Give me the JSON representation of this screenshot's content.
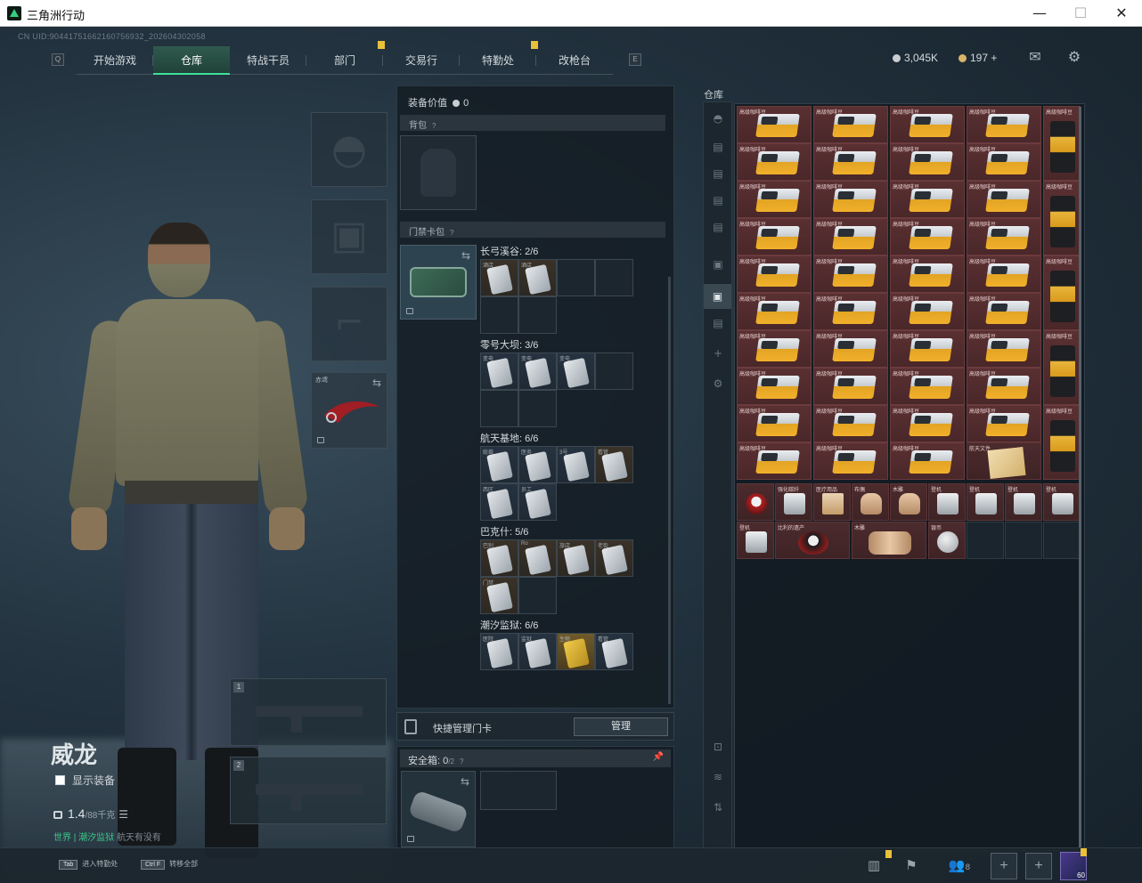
{
  "window": {
    "title": "三角洲行动",
    "minimize": "—",
    "maximize": "☐",
    "close": "✕"
  },
  "uid": "CN UID:904417516621607569​32_202604302058",
  "nav": {
    "left_key": "Q",
    "right_key": "E",
    "tabs": [
      "开始游戏",
      "仓库",
      "特战干员",
      "部门",
      "交易行",
      "特勤处",
      "改枪台"
    ],
    "active_tab": "仓库"
  },
  "currency": {
    "silver": "3,045K",
    "gold": "197",
    "gold_plus": "+"
  },
  "operator": {
    "name": "威龙",
    "show_gear_label": "显示装备",
    "weight": "1.4",
    "weight_max": "/88千克",
    "status_green": "世界 | 潮汐监狱",
    "status_rest": "航天有没有"
  },
  "equipment": {
    "melee_tag": "赤鸢",
    "weapon_slot_1": "1",
    "weapon_slot_2": "2"
  },
  "middle": {
    "gear_value_label": "装备价值",
    "gear_value": "0",
    "backpack_label": "背包",
    "keycase_label": "门禁卡包",
    "maps": [
      {
        "name": "长弓溪谷: 2/6"
      },
      {
        "name": "零号大坝: 3/6"
      },
      {
        "name": "航天基地: 6/6"
      },
      {
        "name": "巴克什: 5/6"
      },
      {
        "name": "潮汐监狱: 6/6"
      }
    ],
    "card_tags": {
      "m1": [
        "酒店",
        "酒店"
      ],
      "m2": [
        "变电",
        "变电",
        "变电"
      ],
      "m3": [
        "総裁",
        "医务",
        "3号",
        "看管",
        "西区",
        "员工"
      ],
      "m4": [
        "巴别",
        "Ro",
        "旅店",
        "老街",
        "门禁"
      ],
      "m5": [
        "医院",
        "监狱",
        "生物",
        "看管",
        "黑狱",
        "二层"
      ]
    },
    "quick_manage": "快捷管理门卡",
    "manage_btn": "管理",
    "safe_label": "安全箱:",
    "safe_count": "0",
    "safe_cap": "/2",
    "question": "?"
  },
  "warehouse": {
    "title": "仓库",
    "coffee_label": "高级咖啡豆",
    "tea_label": "高级咖啡豆",
    "misc_items": [
      {
        "label": "",
        "kind": "red"
      },
      {
        "label": "强化碳纤",
        "kind": "box"
      },
      {
        "label": "医疗用品",
        "kind": "doc"
      },
      {
        "label": "布偶",
        "kind": "doll"
      },
      {
        "label": "木雕",
        "kind": "doll"
      },
      {
        "label": "登机",
        "kind": "box"
      },
      {
        "label": "登机",
        "kind": "box"
      },
      {
        "label": "登机",
        "kind": "box"
      },
      {
        "label": "登机",
        "kind": "box"
      },
      {
        "label": "登机",
        "kind": "box"
      },
      {
        "label": "登机",
        "kind": "box"
      }
    ],
    "doc_label": "航天文件",
    "wide_items": [
      {
        "label": "比利的遗产"
      },
      {
        "label": "木雕"
      }
    ],
    "last_item": {
      "label": "银币"
    }
  },
  "bottom": {
    "hint1_key": "Tab",
    "hint1": "进入特勤处",
    "hint2_key": "Ctrl F",
    "hint2": "转移全部",
    "friends_count": "8",
    "level": "60"
  }
}
